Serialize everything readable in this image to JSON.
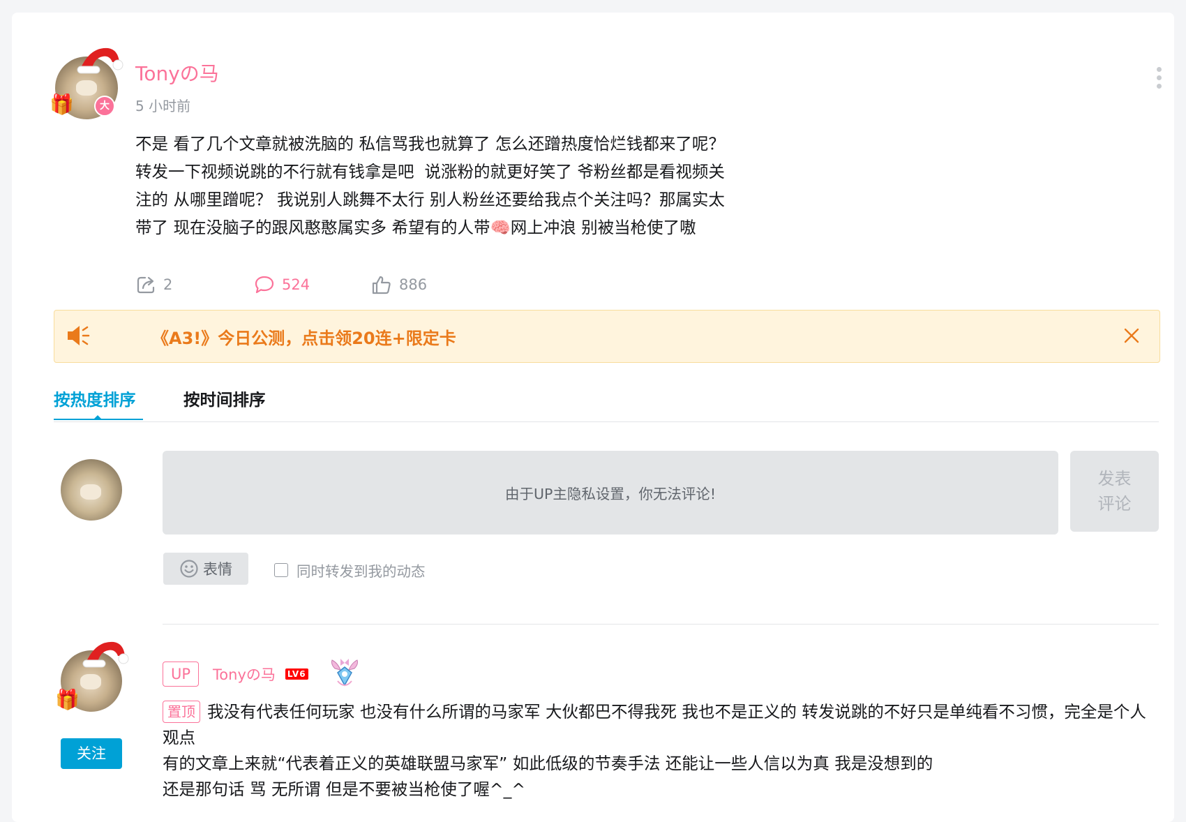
{
  "post": {
    "author": "Tonyの马",
    "time": "5 小时前",
    "vip_badge": "大",
    "text": "不是 看了几个文章就被洗脑的 私信骂我也就算了 怎么还蹭热度恰烂钱都来了呢？\n转发一下视频说跳的不行就有钱拿是吧  说涨粉的就更好笑了 爷粉丝都是看视频关\n注的 从哪里蹭呢？ 我说别人跳舞不太行 别人粉丝还要给我点个关注吗？那属实太\n带了 现在没脑子的跟风憨憨属实多 希望有的人带🧠网上冲浪 别被当枪使了嗷",
    "forward_count": "2",
    "comment_count": "524",
    "like_count": "886"
  },
  "notice": {
    "text": "《A3!》今日公测，点击领20连+限定卡"
  },
  "tabs": {
    "hot": "按热度排序",
    "time": "按时间排序"
  },
  "composer": {
    "disabled_message": "由于UP主隐私设置，你无法评论!",
    "submit_label_line1": "发表",
    "submit_label_line2": "评论",
    "emoji_label": "表情",
    "repost_label": "同时转发到我的动态"
  },
  "reply": {
    "up_tag": "UP",
    "author": "Tonyの马",
    "level": "LV6",
    "follow_label": "关注",
    "pin_tag": "置顶",
    "text": "我没有代表任何玩家 也没有什么所谓的马家军 大伙都巴不得我死 我也不是正义的 转发说跳的不好只是单纯看不习惯，完全是个人观点\n有的文章上来就“代表着正义的英雄联盟马家军” 如此低级的节奏手法 还能让一些人信以为真 我是没想到的\n还是那句话 骂 无所谓 但是不要被当枪使了喔^_^"
  },
  "colors": {
    "pink": "#fb7299",
    "blue": "#00a1d6",
    "notice_bg": "#fff4dd",
    "notice_text": "#ea7a1b"
  }
}
